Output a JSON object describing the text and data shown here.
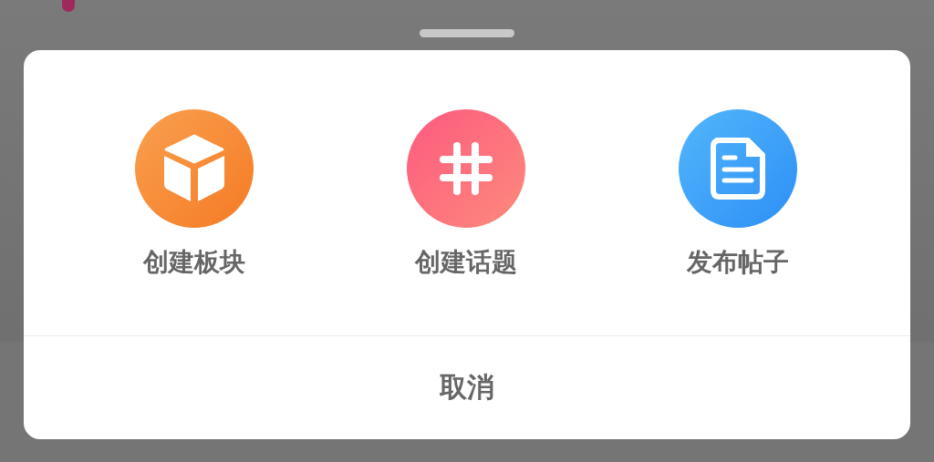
{
  "sheet": {
    "actions": [
      {
        "kind": "cube",
        "label": "创建板块"
      },
      {
        "kind": "hash",
        "label": "创建话题"
      },
      {
        "kind": "document",
        "label": "发布帖子"
      }
    ],
    "cancel": "取消"
  }
}
